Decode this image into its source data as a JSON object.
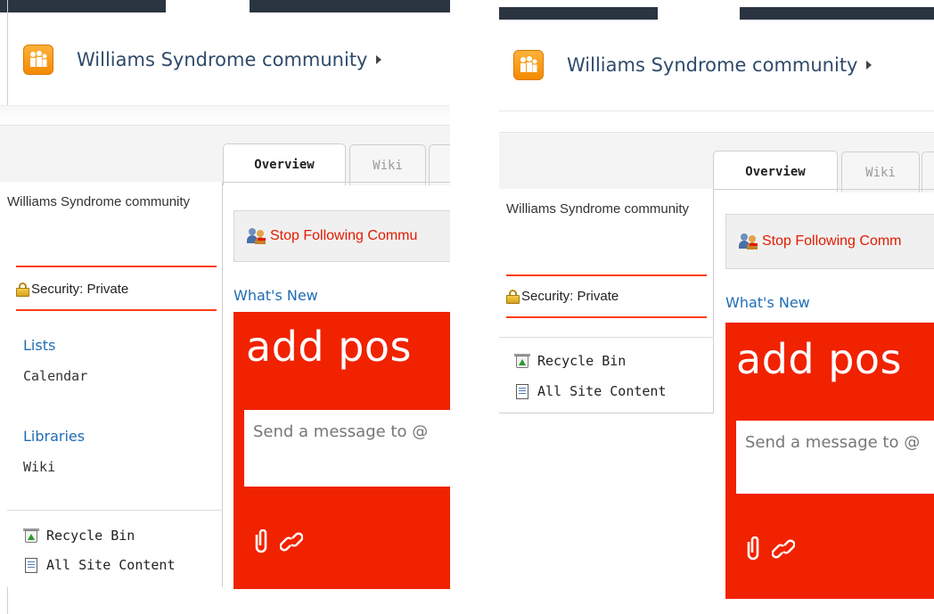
{
  "site": {
    "title": "Williams Syndrome community"
  },
  "tabs": {
    "overview": "Overview",
    "wiki": "Wiki"
  },
  "nav": {
    "community_name": "Williams Syndrome community",
    "security": "Security: Private",
    "lists_heading": "Lists",
    "calendar": "Calendar",
    "libraries_heading": "Libraries",
    "wiki": "Wiki",
    "recycle_bin": "Recycle Bin",
    "all_site_content": "All Site Content"
  },
  "main": {
    "follow_left": "Stop Following Commu",
    "follow_right": "Stop Following Comm",
    "whats_new": "What's New",
    "post_title_left": "add pos",
    "post_title_right": "add pos",
    "msg_placeholder_left": "Send a message to @",
    "msg_placeholder_right": "Send a message to @"
  },
  "colors": {
    "accent_red": "#f12200",
    "link_blue": "#1f6db5",
    "title_blue": "#2f4a6a"
  }
}
